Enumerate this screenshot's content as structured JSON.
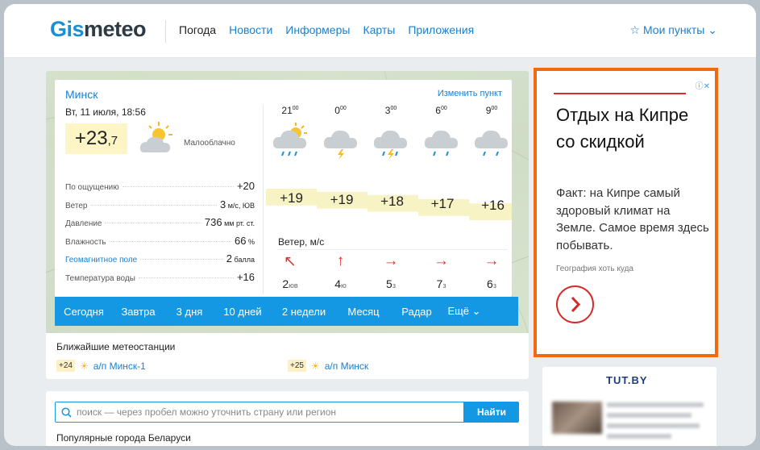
{
  "header": {
    "logo": {
      "part1": "Gis",
      "part2": "meteo"
    },
    "nav": [
      "Погода",
      "Новости",
      "Информеры",
      "Карты",
      "Приложения"
    ],
    "my_points": "☆ Мои пункты ⌄"
  },
  "weather": {
    "city": "Минск",
    "change_point": "Изменить пункт",
    "date": "Вт, 11 июля, 18:56",
    "temp_main": "+23",
    "temp_frac": ",7",
    "condition": "Малооблачно",
    "params": [
      {
        "label": "По ощущению",
        "value": "+20",
        "unit": "",
        "link": false
      },
      {
        "label": "Ветер",
        "value": "3",
        "unit": " м/с, ЮВ",
        "link": false
      },
      {
        "label": "Давление",
        "value": "736",
        "unit": " мм рт. ст.",
        "link": false
      },
      {
        "label": "Влажность",
        "value": "66",
        "unit": " %",
        "link": false
      },
      {
        "label": "Геомагнитное поле",
        "value": "2",
        "unit": " балла",
        "link": true
      },
      {
        "label": "Температура воды",
        "value": "+16",
        "unit": "",
        "link": false
      }
    ],
    "hours": [
      {
        "h": "21",
        "m": "00",
        "icon": "sun-cloud-rain-icon",
        "temp": "+19",
        "arrow": "↖",
        "wind": "2",
        "dir": "юв"
      },
      {
        "h": "0",
        "m": "00",
        "icon": "cloud-thunder-icon",
        "temp": "+19",
        "arrow": "↑",
        "wind": "4",
        "dir": "ю"
      },
      {
        "h": "3",
        "m": "00",
        "icon": "cloud-thunder-rain-icon",
        "temp": "+18",
        "arrow": "→",
        "wind": "5",
        "dir": "з"
      },
      {
        "h": "6",
        "m": "00",
        "icon": "cloud-rain-icon",
        "temp": "+17",
        "arrow": "→",
        "wind": "7",
        "dir": "з"
      },
      {
        "h": "9",
        "m": "00",
        "icon": "cloud-rain-icon",
        "temp": "+16",
        "arrow": "→",
        "wind": "6",
        "dir": "з"
      }
    ],
    "wind_label": "Ветер, м/с",
    "tabs": [
      "Сегодня",
      "Завтра",
      "3 дня",
      "10 дней",
      "2 недели",
      "Месяц",
      "Радар",
      "Ещё ⌄"
    ],
    "stations_title": "Ближайшие метеостанции",
    "stations": [
      {
        "temp": "+24",
        "name": "а/п Минск-1"
      },
      {
        "temp": "+25",
        "name": "а/п Минск"
      }
    ]
  },
  "search": {
    "placeholder": "поиск — через пробел можно уточнить страну или регион",
    "button": "Найти",
    "popular": "Популярные города Беларуси"
  },
  "ad": {
    "title": "Отдых на Кипре со скидкой",
    "desc": "Факт: на Кипре самый здоровый климат на Земле. Самое время здесь побывать.",
    "source": "География хоть куда"
  },
  "ad2": {
    "logo": "TUT.BY"
  },
  "colors": {
    "accent": "#1598e3",
    "link": "#1a7fd0",
    "ad_border": "#f26a0f",
    "temp_bg": "#fdf5c6"
  }
}
